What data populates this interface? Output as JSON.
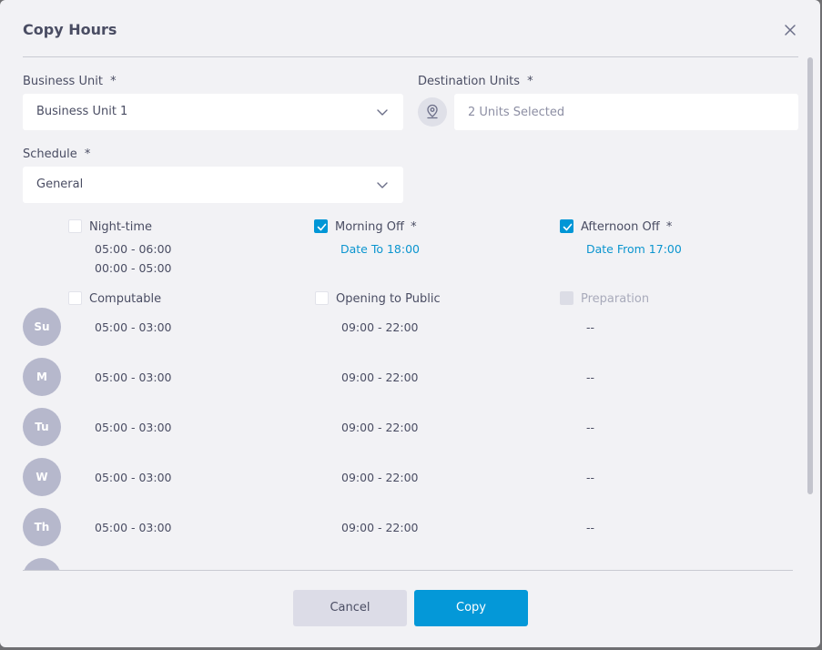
{
  "dialog": {
    "title": "Copy Hours"
  },
  "business_unit": {
    "label": "Business Unit",
    "required_mark": "*",
    "value": "Business Unit 1"
  },
  "destination_units": {
    "label": "Destination Units",
    "required_mark": "*",
    "placeholder": "2 Units Selected"
  },
  "schedule": {
    "label": "Schedule",
    "required_mark": "*",
    "value": "General"
  },
  "options": {
    "night_time": {
      "label": "Night-time",
      "checked": false,
      "lines": [
        "05:00 - 06:00",
        "00:00 - 05:00"
      ]
    },
    "morning_off": {
      "label": "Morning Off",
      "required_mark": "*",
      "checked": true,
      "detail": "Date To 18:00"
    },
    "afternoon_off": {
      "label": "Afternoon Off",
      "required_mark": "*",
      "checked": true,
      "detail": "Date From 17:00"
    },
    "computable": {
      "label": "Computable",
      "checked": false
    },
    "opening_to_public": {
      "label": "Opening to Public",
      "checked": false
    },
    "preparation": {
      "label": "Preparation",
      "checked": false,
      "disabled": true
    }
  },
  "days": [
    {
      "abbr": "Su",
      "computable": "05:00 - 03:00",
      "opening": "09:00 - 22:00",
      "preparation": "--"
    },
    {
      "abbr": "M",
      "computable": "05:00 - 03:00",
      "opening": "09:00 - 22:00",
      "preparation": "--"
    },
    {
      "abbr": "Tu",
      "computable": "05:00 - 03:00",
      "opening": "09:00 - 22:00",
      "preparation": "--"
    },
    {
      "abbr": "W",
      "computable": "05:00 - 03:00",
      "opening": "09:00 - 22:00",
      "preparation": "--"
    },
    {
      "abbr": "Th",
      "computable": "05:00 - 03:00",
      "opening": "09:00 - 22:00",
      "preparation": "--"
    }
  ],
  "footer": {
    "cancel_label": "Cancel",
    "copy_label": "Copy"
  },
  "colors": {
    "accent": "#0498d8",
    "day_badge": "#b6b8cc",
    "background": "#f2f2f5"
  }
}
